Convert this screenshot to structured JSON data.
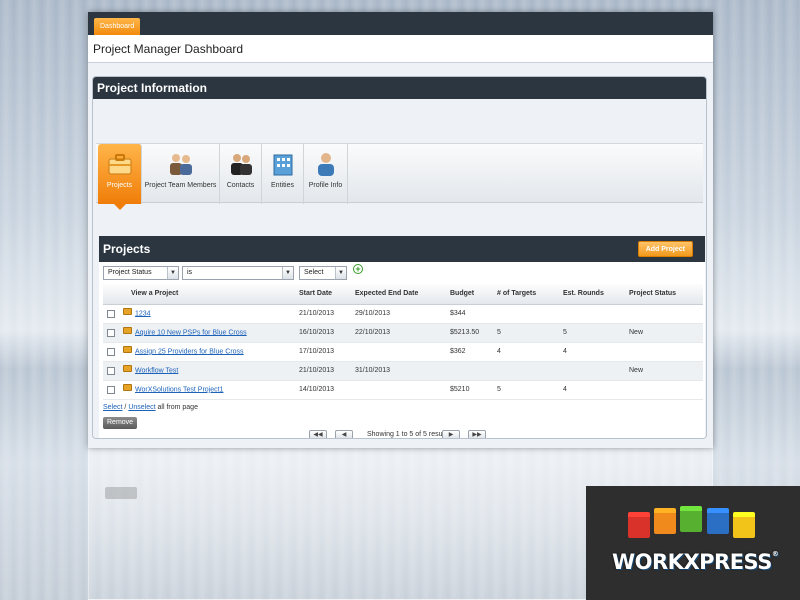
{
  "tab": {
    "label": "Dashboard"
  },
  "page_title": "Project Manager Dashboard",
  "panel": {
    "title": "Project Information"
  },
  "nav": [
    {
      "label": "Projects",
      "icon": "briefcase-icon"
    },
    {
      "label": "Project Team Members",
      "icon": "team-icon"
    },
    {
      "label": "Contacts",
      "icon": "contacts-icon"
    },
    {
      "label": "Entities",
      "icon": "entities-icon"
    },
    {
      "label": "Profile Info",
      "icon": "profile-icon"
    }
  ],
  "projects": {
    "title": "Projects",
    "add_button": "Add Project",
    "filters": {
      "field": "Project Status",
      "operator": "is",
      "value": "",
      "select": "Select"
    },
    "columns": [
      "View a Project",
      "Start Date",
      "Expected End Date",
      "Budget",
      "# of Targets",
      "Est. Rounds",
      "Project Status"
    ],
    "rows": [
      {
        "name": "1234",
        "start": "21/10/2013",
        "end": "29/10/2013",
        "budget": "$344",
        "targets": "",
        "rounds": "",
        "status": ""
      },
      {
        "name": "Aquire 10 New PSPs for Blue Cross",
        "start": "16/10/2013",
        "end": "22/10/2013",
        "budget": "$5213.50",
        "targets": "5",
        "rounds": "5",
        "status": "New"
      },
      {
        "name": "Assign 25 Providers for Blue Cross",
        "start": "17/10/2013",
        "end": "",
        "budget": "$362",
        "targets": "4",
        "rounds": "4",
        "status": ""
      },
      {
        "name": "Workflow Test",
        "start": "21/10/2013",
        "end": "31/10/2013",
        "budget": "",
        "targets": "",
        "rounds": "",
        "status": "New"
      },
      {
        "name": "WorXSolutions Test Project1",
        "start": "14/10/2013",
        "end": "",
        "budget": "$5210",
        "targets": "5",
        "rounds": "4",
        "status": ""
      }
    ],
    "select_link": "Select",
    "unselect_link": "Unselect",
    "select_suffix": "all from page",
    "remove_button": "Remove",
    "pager_info": "Showing 1 to 5 of 5 results"
  },
  "logo": {
    "text": "WORKXPRESS",
    "reg": "®"
  },
  "colors": {
    "header_dark": "#2b3640",
    "accent_orange": "#f28a0c",
    "link_blue": "#1c62b9"
  }
}
